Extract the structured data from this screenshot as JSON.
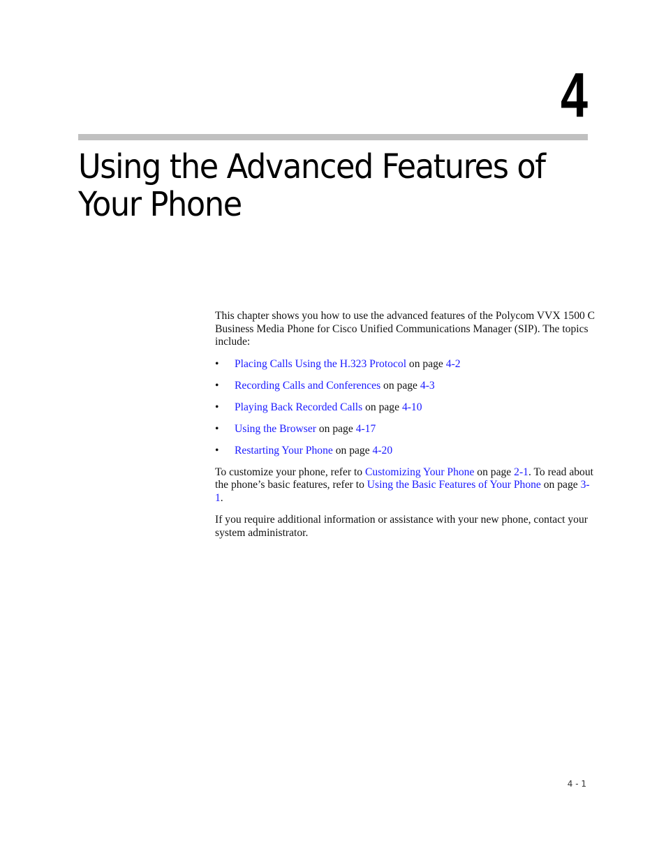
{
  "chapter": {
    "number": "4",
    "title": "Using the Advanced Features of Your Phone"
  },
  "intro": "This chapter shows you how to use the advanced features of the Polycom VVX 1500 C Business Media Phone for Cisco Unified Communications Manager (SIP). The topics include:",
  "topics": [
    {
      "bullet": "•",
      "link": "Placing Calls Using the H.323 Protocol",
      "on_page": " on page ",
      "page": "4-2"
    },
    {
      "bullet": "•",
      "link": "Recording Calls and Conferences",
      "on_page": " on page ",
      "page": "4-3"
    },
    {
      "bullet": "•",
      "link": "Playing Back Recorded Calls",
      "on_page": " on page ",
      "page": "4-10"
    },
    {
      "bullet": "•",
      "link": "Using the Browser",
      "on_page": " on page ",
      "page": "4-17"
    },
    {
      "bullet": "•",
      "link": "Restarting Your Phone",
      "on_page": " on page ",
      "page": "4-20"
    }
  ],
  "customize": {
    "text1": "To customize your phone, refer to ",
    "link1": "Customizing Your Phone",
    "text2": " on page ",
    "page1": "2-1",
    "text3": ". To read about the phone’s basic features, refer to ",
    "link2": "Using the Basic Features of Your Phone",
    "text4": " on page ",
    "page2": "3-1",
    "text5": "."
  },
  "closing": "If you require additional information or assistance with your new phone, contact your system administrator.",
  "footer": {
    "page_number": "4 - 1"
  },
  "colors": {
    "link": "#1a1aff",
    "rule": "#c0c0c0"
  }
}
